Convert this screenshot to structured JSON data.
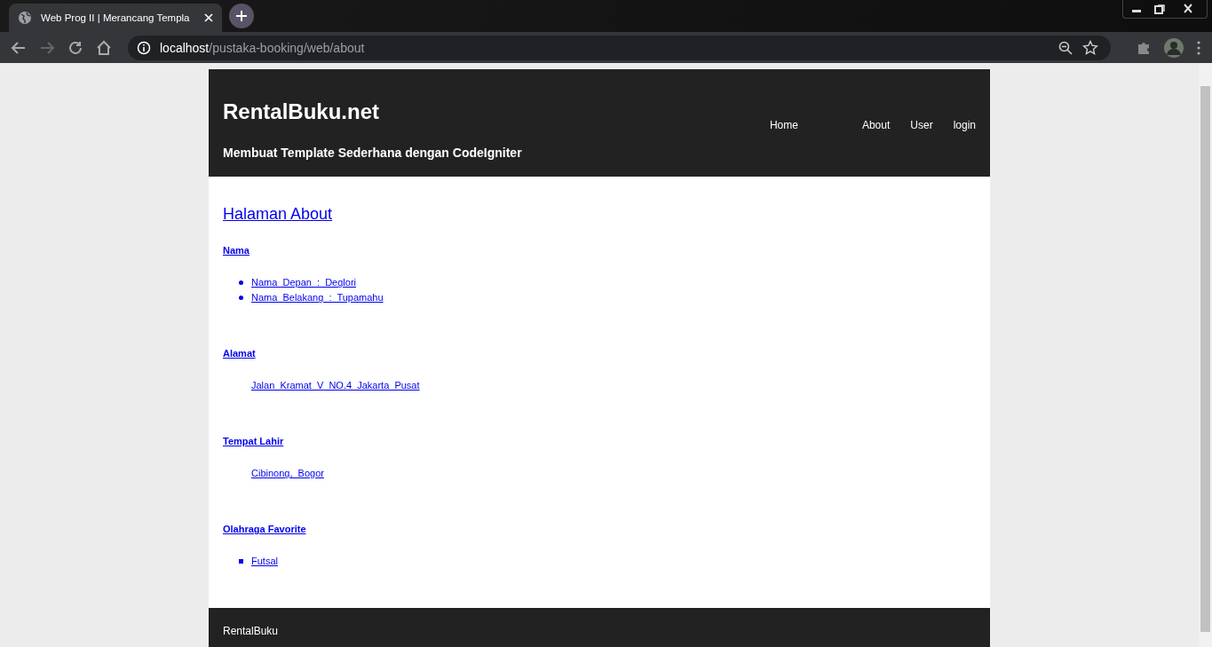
{
  "browser": {
    "tab_title": "Web Prog II | Merancang Templa",
    "address_host": "localhost",
    "address_path": "/pustaka-booking/web/about"
  },
  "header": {
    "brand": "RentalBuku.net",
    "tagline": "Membuat Template Sederhana dengan CodeIgniter",
    "nav": [
      {
        "label": "Home"
      },
      {
        "label": "About"
      },
      {
        "label": "User"
      },
      {
        "label": "login"
      }
    ]
  },
  "content": {
    "title": "Halaman About",
    "sections": [
      {
        "heading": "Nama",
        "items": [
          {
            "kind": "disc",
            "text": "Nama  Depan  :  Deglori"
          },
          {
            "kind": "disc",
            "text": "Nama  Belakang  :  Tupamahu"
          }
        ]
      },
      {
        "heading": "Alamat",
        "items": [
          {
            "kind": "plain",
            "text": "Jalan  Kramat  V  NO.4  Jakarta  Pusat"
          }
        ]
      },
      {
        "heading": "Tempat Lahir",
        "items": [
          {
            "kind": "plain",
            "text": "Cibinong,  Bogor"
          }
        ]
      },
      {
        "heading": "Olahraga Favorite",
        "items": [
          {
            "kind": "square",
            "text": "Futsal"
          }
        ]
      }
    ]
  },
  "footer": {
    "text": "RentalBuku"
  }
}
